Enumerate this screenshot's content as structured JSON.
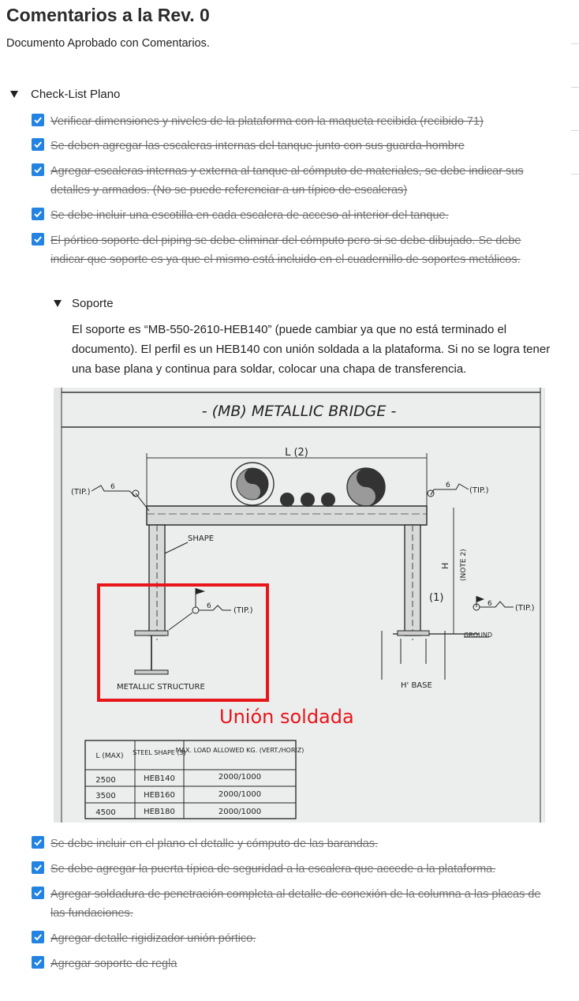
{
  "page": {
    "title": "Comentarios a la Rev. 0",
    "subtitle": "Documento Aprobado con Comentarios."
  },
  "checklist": {
    "toggle_label": "Check-List Plano",
    "items_top": [
      {
        "text": "Verificar dimensiones y niveles de la plataforma con la maqueta recibida (recibido 71)",
        "checked": true
      },
      {
        "text": "Se deben agregar las escaleras internas del tanque junto con sus guarda-hombre",
        "checked": true
      },
      {
        "text": "Agregar escaleras internas y externa al tanque al cómputo de materiales, se debe indicar sus detalles y armados. (No se puede referenciar a un típico de escaleras)",
        "checked": true
      },
      {
        "text": "Se debe incluir una escotilla en cada escalera de acceso al interior del tanque.",
        "checked": true
      },
      {
        "text": "El pórtico soporte del piping se debe eliminar del cómputo pero si se debe dibujado. Se debe indicar que soporte es ya que el mismo está incluido en el cuadernillo de soportes metálicos.",
        "checked": true
      }
    ],
    "items_bottom": [
      {
        "text": "Se debe incluir en el plano el detalle y cómputo de las barandas.",
        "checked": true
      },
      {
        "text": "Se debe agregar la puerta típica de seguridad a la escalera que accede a la plataforma.",
        "checked": true
      },
      {
        "text": "Agregar soldadura de penetración completa al detalle de conexión de la columna a las placas de las fundaciones.",
        "checked": true
      },
      {
        "text": "Agregar detalle rigidizador unión pórtico.",
        "checked": true
      },
      {
        "text": "Agregar soporte de regla",
        "checked": true
      }
    ]
  },
  "soporte": {
    "toggle_label": "Soporte",
    "paragraph": "El soporte es “MB-550-2610-HEB140”   (puede cambiar ya que no está terminado el documento). El perfil es un HEB140 con unión soldada a la plataforma. Si no se logra tener una base plana y continua para soldar, colocar una chapa de transferencia."
  },
  "drawing": {
    "header": "- (MB) METALLIC BRIDGE -",
    "dim_top": "L (2)",
    "tip_left": "(TIP.)",
    "tip_right": "(TIP.)",
    "tip_mid": "(TIP.)",
    "weld_size_left": "6",
    "weld_size_right": "6",
    "weld_size_mid": "6",
    "shape_label": "SHAPE",
    "h_label": "H",
    "note_label": "(NOTE 2)",
    "marker_1": "(1)",
    "ground_label": "GROUND",
    "metallic_structure_label": "METALLIC STRUCTURE",
    "h_base_label": "H' BASE",
    "annotation": "Unión soldada",
    "annotation_color": "#e8151b",
    "table": {
      "headers": [
        "L (MAX)",
        "STEEL SHAPE (3)",
        "MAX. LOAD ALLOWED KG. (VERT./HORIZ)"
      ],
      "rows": [
        [
          "2500",
          "HEB140",
          "2000/1000"
        ],
        [
          "3500",
          "HEB160",
          "2000/1000"
        ],
        [
          "4500",
          "HEB180",
          "2000/1000"
        ]
      ]
    }
  },
  "colors": {
    "checkbox": "#2383e2",
    "strike_text": "#7a7a7a"
  }
}
